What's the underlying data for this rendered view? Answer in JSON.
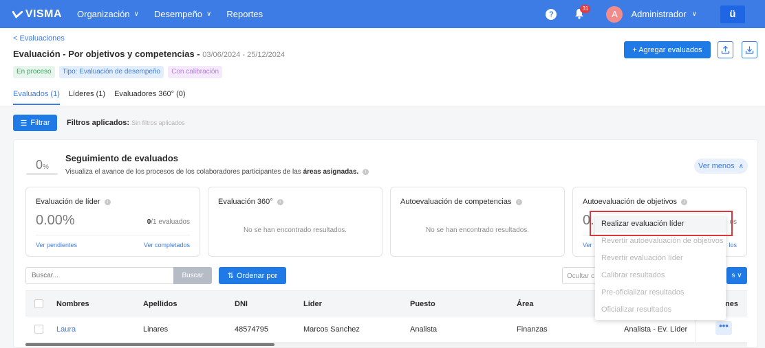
{
  "nav": {
    "brand": "VISMA",
    "items": [
      {
        "label": "Organización",
        "has_dropdown": true
      },
      {
        "label": "Desempeño",
        "has_dropdown": true
      },
      {
        "label": "Reportes",
        "has_dropdown": false
      }
    ],
    "help": "?",
    "notifications_count": "31",
    "avatar_initial": "A",
    "user_name": "Administrador",
    "app_logo": "ü"
  },
  "header": {
    "back_link": "< Evaluaciones",
    "title": "Evaluación - Por objetivos y competencias - ",
    "dates": "03/06/2024 - 25/12/2024",
    "chips": [
      "En proceso",
      "Tipo: Evaluación de desempeño",
      "Con calibración"
    ],
    "add_button": "+ Agregar evaluados"
  },
  "tabs": [
    "Evaluados (1)",
    "Líderes (1)",
    "Evaluadores 360° (0)"
  ],
  "filters": {
    "button": "Filtrar",
    "applied_label": "Filtros aplicados:",
    "applied_value": "Sin filtros aplicados"
  },
  "tracking": {
    "percent": "0",
    "percent_unit": "%",
    "progress_fraction": 0,
    "title": "Seguimiento de evaluados",
    "subtitle_prefix": "Visualiza el avance de los procesos de los colaboradores participantes de las ",
    "subtitle_bold": "áreas asignadas.",
    "toggle_label": "Ver menos"
  },
  "stats": [
    {
      "title": "Evaluación de líder",
      "value": "0.00%",
      "count_done": "0",
      "count_suffix": "/1 evaluados",
      "link_left": "Ver pendientes",
      "link_right": "Ver completados"
    },
    {
      "title": "Evaluación 360°",
      "empty": "No se han encontrado resultados."
    },
    {
      "title": "Autoevaluación de competencias",
      "empty": "No se han encontrado resultados."
    },
    {
      "title": "Autoevaluación de objetivos",
      "value_partial": "0.",
      "count_partial": "os",
      "link_left_partial": "Ver",
      "link_right_partial": "los"
    }
  ],
  "search": {
    "placeholder": "Buscar...",
    "button": "Buscar",
    "sort_button": "Ordenar por",
    "hide_columns": "Ocultar c",
    "cols_chevron": "s ∨"
  },
  "table": {
    "headers": [
      "Nombres",
      "Apellidos",
      "DNI",
      "Líder",
      "Puesto",
      "Área",
      "nes"
    ],
    "rows": [
      {
        "nombres": "Laura",
        "apellidos": "Linares",
        "dni": "48574795",
        "lider": "Marcos Sanchez",
        "puesto": "Analista",
        "area": "Finanzas",
        "tipo": "Analista - Ev. Líder"
      }
    ]
  },
  "menu": {
    "items": [
      {
        "label": "Realizar evaluación líder",
        "enabled": true
      },
      {
        "label": "Revertir autoevaluación de objetivos",
        "enabled": false
      },
      {
        "label": "Revertir evaluación líder",
        "enabled": false
      },
      {
        "label": "Calibrar resultados",
        "enabled": false
      },
      {
        "label": "Pre-oficializar resultados",
        "enabled": false
      },
      {
        "label": "Oficializar resultados",
        "enabled": false
      }
    ]
  },
  "colors": {
    "primary": "#3d7ce5",
    "button": "#1f7ae6",
    "highlight": "#d9373b"
  }
}
